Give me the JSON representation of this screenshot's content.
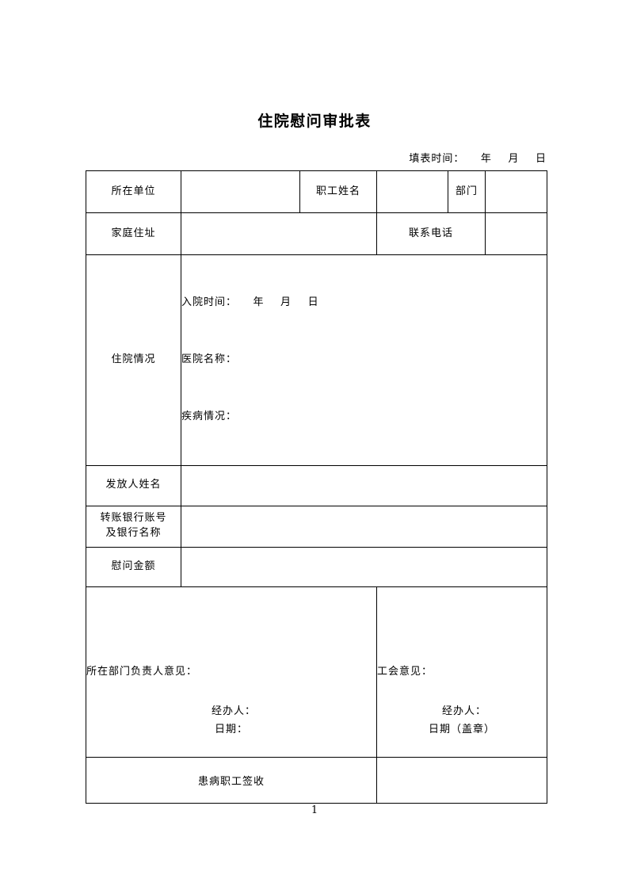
{
  "document": {
    "title": "住院慰问审批表",
    "fill_date_line": "填表时间：    年    月    日",
    "page_number": "1"
  },
  "table": {
    "row_unit": {
      "label_unit": "所在单位",
      "value_unit": "",
      "label_name": "职工姓名",
      "value_name": "",
      "label_dept": "部门",
      "value_dept": ""
    },
    "row_address": {
      "label_address": "家庭住址",
      "value_address": "",
      "label_phone": "联系电话",
      "value_phone": ""
    },
    "row_hospital": {
      "label": "住院情况",
      "line_admit": "入院时间：    年    月    日",
      "line_hospital_name": "医院名称：",
      "line_illness": "疾病情况："
    },
    "row_payee": {
      "label": "发放人姓名",
      "value": ""
    },
    "row_bank": {
      "label_line1": "转账银行账号",
      "label_line2": "及银行名称",
      "value": ""
    },
    "row_amount": {
      "label": "慰问金额",
      "value": ""
    },
    "row_opinions": {
      "dept_head": "所在部门负责人意见：",
      "dept_handler": "经办人：",
      "dept_date": "日期：",
      "union_head": "工会意见：",
      "union_handler": "经办人：",
      "union_date": "日期（盖章）"
    },
    "row_signature": {
      "label": "患病职工签收",
      "value": ""
    }
  }
}
